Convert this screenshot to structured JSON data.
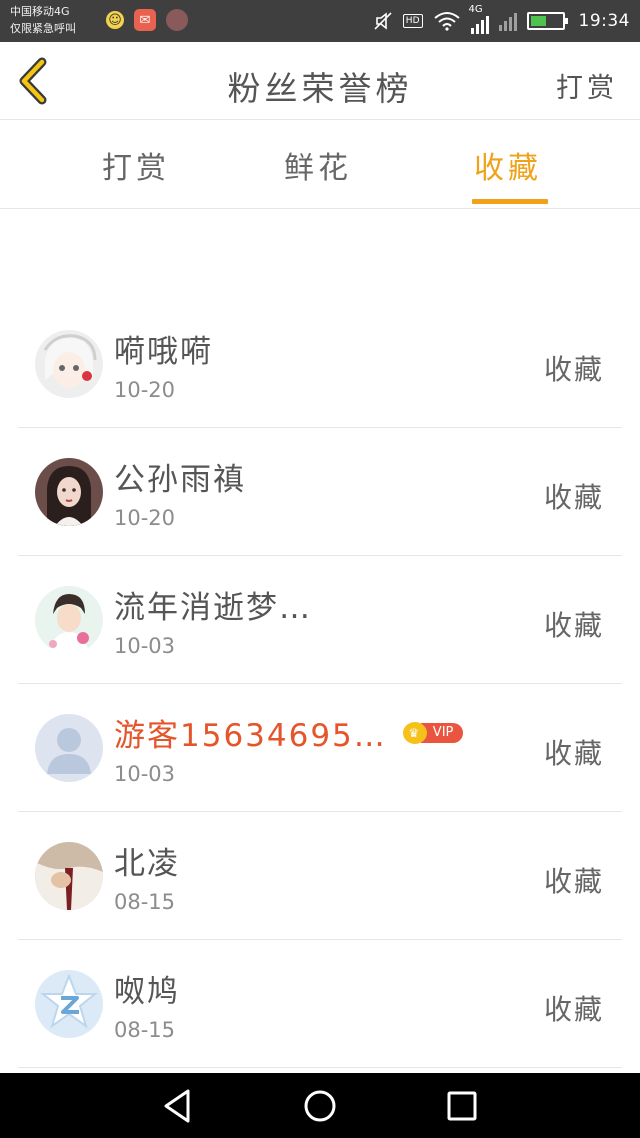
{
  "status_bar": {
    "carrier_line1": "中国移动4G",
    "carrier_line2": "仅限紧急呼叫",
    "hd_label": "HD",
    "network_label": "4G",
    "time": "19:34"
  },
  "header": {
    "title": "粉丝荣誉榜",
    "action_label": "打赏",
    "back_icon": "chevron-left-icon"
  },
  "tabs": [
    {
      "label": "打赏",
      "active": false
    },
    {
      "label": "鲜花",
      "active": false
    },
    {
      "label": "收藏",
      "active": true
    }
  ],
  "colors": {
    "accent": "#f0a21b",
    "guest_name": "#e4552b",
    "vip_badge": "#e9553e"
  },
  "fans": [
    {
      "name": "嗬哦嗬",
      "date": "10-20",
      "action": "收藏",
      "vip": false
    },
    {
      "name": "公孙雨禛",
      "date": "10-20",
      "action": "收藏",
      "vip": false
    },
    {
      "name": "流年消逝梦…",
      "date": "10-03",
      "action": "收藏",
      "vip": false
    },
    {
      "name": "游客15634695…",
      "date": "10-03",
      "action": "收藏",
      "vip": true,
      "vip_label": "VIP"
    },
    {
      "name": "北凌",
      "date": "08-15",
      "action": "收藏",
      "vip": false
    },
    {
      "name": "呶鸠",
      "date": "08-15",
      "action": "收藏",
      "vip": false
    }
  ]
}
